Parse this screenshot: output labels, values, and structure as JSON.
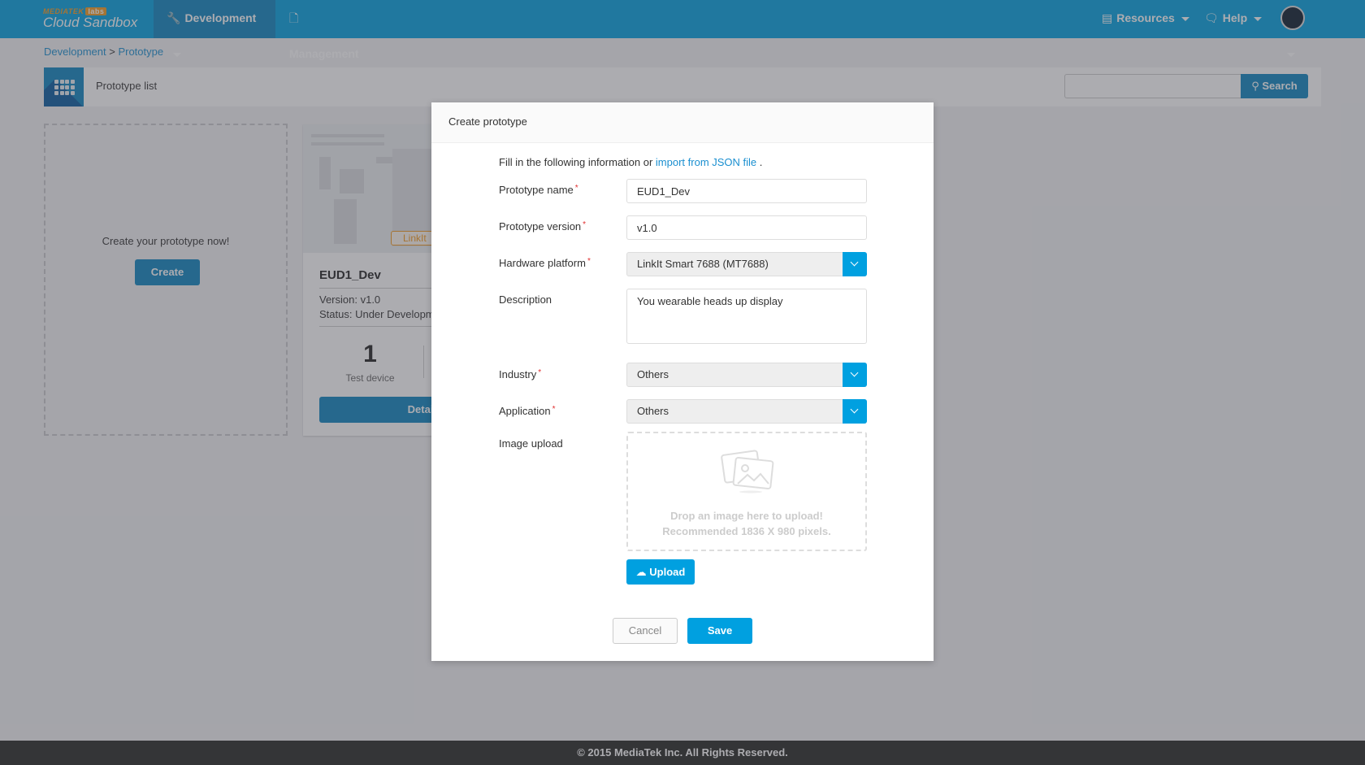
{
  "navbar": {
    "brand_top": "MEDIATEK",
    "brand_labs": "labs",
    "brand_name": "Cloud Sandbox",
    "items": [
      {
        "label": "Development",
        "icon": "wrench-icon"
      },
      {
        "label": "Management",
        "icon": "documents-icon"
      },
      {
        "label": "Resources",
        "icon": "inbox-icon"
      },
      {
        "label": "Help",
        "icon": "chat-icon"
      }
    ]
  },
  "breadcrumb": {
    "items": [
      "Development",
      "Prototype"
    ],
    "separator": ">"
  },
  "toolbar": {
    "title": "Prototype list",
    "search_placeholder": "",
    "search_label": "Search"
  },
  "create_card": {
    "text": "Create your prototype now!",
    "button": "Create"
  },
  "prototype_card": {
    "tag": "LinkIt",
    "name": "EUD1_Dev",
    "version": "Version: v1.0",
    "status": "Status: Under Development",
    "stat_value": "1",
    "stat_label": "Test device",
    "details_button": "Details"
  },
  "modal": {
    "title": "Create prototype",
    "intro_text": "Fill in the following information or ",
    "intro_link": "import from JSON file",
    "intro_end": " .",
    "fields": {
      "name": {
        "label": "Prototype name",
        "required": true,
        "value": "EUD1_Dev"
      },
      "version": {
        "label": "Prototype version",
        "required": true,
        "value": "v1.0"
      },
      "hardware": {
        "label": "Hardware platform",
        "required": true,
        "value": "LinkIt Smart 7688 (MT7688)"
      },
      "description": {
        "label": "Description",
        "required": false,
        "value": "You wearable heads up display"
      },
      "industry": {
        "label": "Industry",
        "required": true,
        "value": "Others"
      },
      "application": {
        "label": "Application",
        "required": true,
        "value": "Others"
      },
      "image": {
        "label": "Image upload",
        "drop_text": "Drop an image here to upload!",
        "recommend_text": "Recommended 1836 X 980 pixels."
      }
    },
    "required_mark": "*",
    "upload_button": "Upload",
    "cancel_button": "Cancel",
    "save_button": "Save"
  },
  "footer": {
    "text": "© 2015 MediaTek Inc. All Rights Reserved."
  },
  "colors": {
    "brand": "#00a0e0",
    "accent_dark": "#0b84c0",
    "required": "#e03030",
    "link": "#1a8fd0",
    "tag": "#f39a1e"
  }
}
